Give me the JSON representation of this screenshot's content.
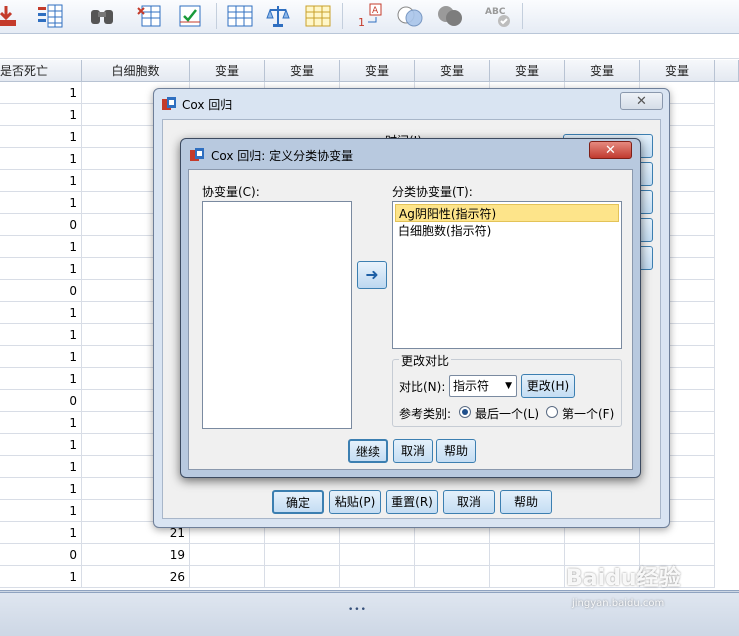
{
  "grid": {
    "headers": [
      "是否死亡",
      "白细胞数",
      "变量",
      "变量",
      "变量",
      "变量",
      "变量",
      "变量",
      "变量"
    ],
    "death": [
      "1",
      "1",
      "1",
      "1",
      "1",
      "1",
      "0",
      "1",
      "1",
      "0",
      "1",
      "1",
      "1",
      "1",
      "0",
      "1",
      "1",
      "1",
      "1",
      "1",
      "1",
      "0",
      "1"
    ],
    "wbc_visible": [
      {
        "row": 21,
        "value": "21"
      },
      {
        "row": 22,
        "value": "19"
      },
      {
        "row": 23,
        "value": "26"
      }
    ],
    "wbc_partial_top": "100"
  },
  "outer_dialog": {
    "title": "Cox 回归",
    "time_label": "时间(I):",
    "buttons": {
      "ok": "确定",
      "paste": "粘贴(P)",
      "reset": "重置(R)",
      "cancel": "取消",
      "help": "帮助"
    }
  },
  "inner_dialog": {
    "title": "Cox 回归: 定义分类协变量",
    "covariates_label": "协变量(C):",
    "covariates_key": "C",
    "categorical_label": "分类协变量(T):",
    "categorical_items": [
      "Ag阴阳性(指示符)",
      "白细胞数(指示符)"
    ],
    "change_group_title": "更改对比",
    "contrast_label": "对比(N):",
    "contrast_value": "指示符",
    "change_button": "更改(H)",
    "reference_label": "参考类别:",
    "ref_last": "最后一个(L)",
    "ref_first": "第一个(F)",
    "ref_selected": "last",
    "buttons": {
      "continue": "继续",
      "cancel": "取消",
      "help": "帮助"
    }
  },
  "watermark": {
    "text": "Baidu经验",
    "sub": "jingyan.baidu.com"
  },
  "colors": {
    "accent": "#3c7fb1",
    "selection": "#fde48a",
    "close": "#c9463d"
  }
}
